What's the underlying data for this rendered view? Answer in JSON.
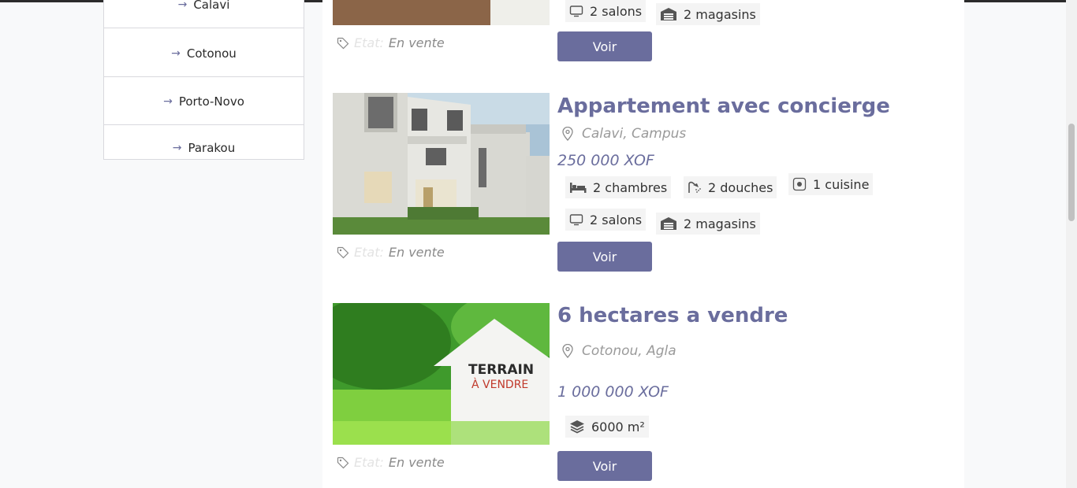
{
  "sidebar": {
    "items": [
      {
        "label": "Calavi"
      },
      {
        "label": "Cotonou"
      },
      {
        "label": "Porto-Novo"
      },
      {
        "label": "Parakou"
      }
    ]
  },
  "listings": [
    {
      "features": [
        {
          "icon": "tv-icon",
          "text": "2 salons"
        },
        {
          "icon": "garage-icon",
          "text": "2 magasins"
        }
      ],
      "etat_label": "Etat:",
      "etat_value": "En vente",
      "button": "Voir"
    },
    {
      "title": "Appartement avec concierge",
      "location": "Calavi, Campus",
      "price": "250 000 XOF",
      "features": [
        {
          "icon": "bed-icon",
          "text": "2 chambres"
        },
        {
          "icon": "shower-icon",
          "text": "2 douches"
        },
        {
          "icon": "stove-icon",
          "text": "1 cuisine"
        },
        {
          "icon": "tv-icon",
          "text": "2 salons"
        },
        {
          "icon": "garage-icon",
          "text": "2 magasins"
        }
      ],
      "etat_label": "Etat:",
      "etat_value": "En vente",
      "button": "Voir"
    },
    {
      "title": "6 hectares a vendre",
      "location": "Cotonou, Agla",
      "price": "1 000 000 XOF",
      "features": [
        {
          "icon": "layers-icon",
          "text": "6000 m²"
        }
      ],
      "image_text_1": "TERRAIN",
      "image_text_2": "À VENDRE",
      "etat_label": "Etat:",
      "etat_value": "En vente",
      "button": "Voir"
    }
  ],
  "colors": {
    "accent": "#6a6d9d",
    "muted": "#9a9a9a"
  }
}
